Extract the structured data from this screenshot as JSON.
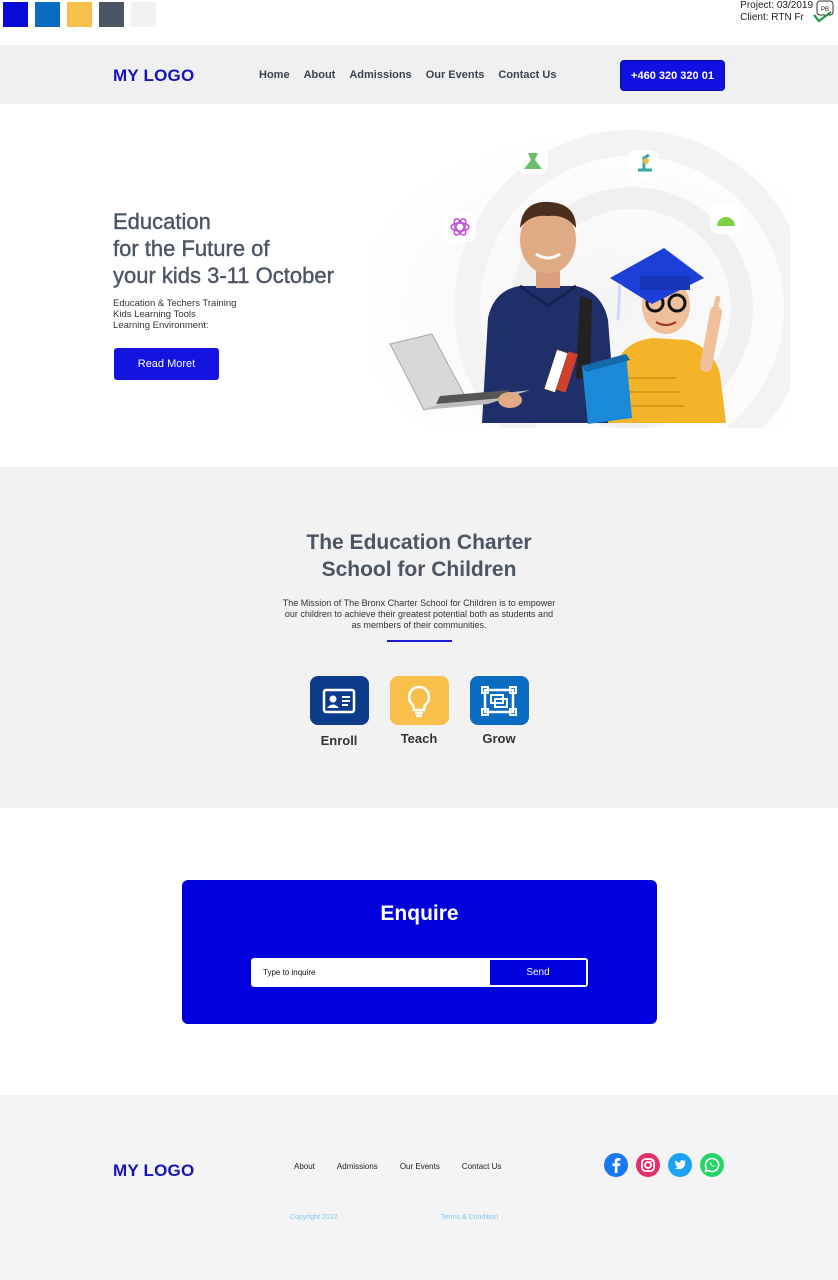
{
  "palette": [
    "#0a0ad8",
    "#0a6cc0",
    "#f7c04a",
    "#4b5563",
    "#f2f2f2"
  ],
  "project": {
    "line1": "Project: 03/2019",
    "line2": "Client: RTN Fr",
    "badge": "PB"
  },
  "header": {
    "logo": "MY LOGO",
    "nav": [
      "Home",
      "About",
      "Admissions",
      "Our Events",
      "Contact Us"
    ],
    "phone": "+460 320 320 01"
  },
  "hero": {
    "title": [
      "Education",
      "for the Future of",
      "your kids 3-11 October"
    ],
    "list": [
      "Education & Techers Training",
      "Kids Learning Tools",
      "Learning Environment:"
    ],
    "button": "Read Moret"
  },
  "mission": {
    "title": [
      "The Education Charter",
      "School for Children"
    ],
    "text": [
      "The Mission of The Bronx Charter School for Children is to empower",
      "our children to achieve their greatest potential both as students and",
      "as members of their communities."
    ],
    "features": [
      {
        "label": "Enroll",
        "icon": "id-card-icon",
        "color": "#0d3b8c"
      },
      {
        "label": "Teach",
        "icon": "lightbulb-icon",
        "color": "#f7c04a"
      },
      {
        "label": "Grow",
        "icon": "screen-frame-icon",
        "color": "#0a6cc0"
      }
    ]
  },
  "enquire": {
    "title": "Enquire",
    "placeholder": "Type to inquire",
    "button": "Send"
  },
  "footer": {
    "logo": "MY LOGO",
    "nav": [
      "About",
      "Admissions",
      "Our Events",
      "Contact Us"
    ],
    "socials": [
      "facebook-icon",
      "instagram-icon",
      "twitter-icon",
      "whatsapp-icon"
    ],
    "copyright": "Copyright 2022",
    "terms": "Terms & Condition"
  }
}
